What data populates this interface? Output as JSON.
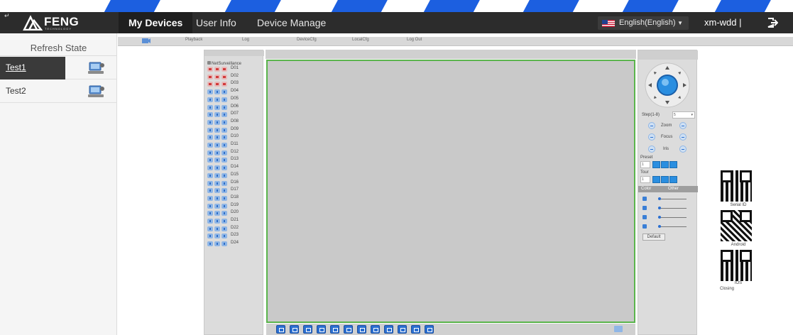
{
  "app": {
    "logo_text": "FENG",
    "logo_subtext": "TECHNOLOGY",
    "corner_glyph": "↵"
  },
  "nav": {
    "items": [
      {
        "label": "My Devices",
        "active": true
      },
      {
        "label": "User Info",
        "active": false
      },
      {
        "label": "Device Manage",
        "active": false
      }
    ]
  },
  "language": {
    "label": "English(English)",
    "flag": "us-flag-icon"
  },
  "user": {
    "name": "xm-wdd |",
    "logout_icon": "logout-icon"
  },
  "sidebar": {
    "refresh_label": "Refresh State",
    "devices": [
      {
        "name": "Test1",
        "selected": true,
        "icon": "device-monitor-icon"
      },
      {
        "name": "Test2",
        "selected": false,
        "icon": "device-monitor-icon"
      }
    ]
  },
  "subtabs": [
    "Playback",
    "Log",
    "DeviceCfg",
    "LocalCfg",
    "Log Out"
  ],
  "channels": {
    "root_label": "NetSurveillance",
    "items": [
      {
        "label": "D01",
        "online": false
      },
      {
        "label": "D02",
        "online": false
      },
      {
        "label": "D03",
        "online": false
      },
      {
        "label": "D04",
        "online": true
      },
      {
        "label": "D05",
        "online": true
      },
      {
        "label": "D06",
        "online": true
      },
      {
        "label": "D07",
        "online": true
      },
      {
        "label": "D08",
        "online": true
      },
      {
        "label": "D09",
        "online": true
      },
      {
        "label": "D10",
        "online": true
      },
      {
        "label": "D11",
        "online": true
      },
      {
        "label": "D12",
        "online": true
      },
      {
        "label": "D13",
        "online": true
      },
      {
        "label": "D14",
        "online": true
      },
      {
        "label": "D15",
        "online": true
      },
      {
        "label": "D16",
        "online": true
      },
      {
        "label": "D17",
        "online": true
      },
      {
        "label": "D18",
        "online": true
      },
      {
        "label": "D19",
        "online": true
      },
      {
        "label": "D20",
        "online": true
      },
      {
        "label": "D21",
        "online": true
      },
      {
        "label": "D22",
        "online": true
      },
      {
        "label": "D23",
        "online": true
      },
      {
        "label": "D24",
        "online": true
      }
    ]
  },
  "ptz": {
    "step_label": "Step(1-8)",
    "step_value": "5",
    "zoom_label": "Zoom",
    "focus_label": "Focus",
    "iris_label": "Iris",
    "preset_label": "Preset",
    "preset_value": "1",
    "tour_label": "Tour",
    "tour_value": "1",
    "tab_color": "Color",
    "tab_other": "Other",
    "default_label": "Default"
  },
  "qr": {
    "serial_label": "Serial ID",
    "android_label": "Android",
    "ios_label": "IOS",
    "closing_label": "Closing"
  },
  "colors": {
    "accent": "#2a6fd1",
    "topbar": "#2c2c2c",
    "video_border": "#5ab44c"
  }
}
